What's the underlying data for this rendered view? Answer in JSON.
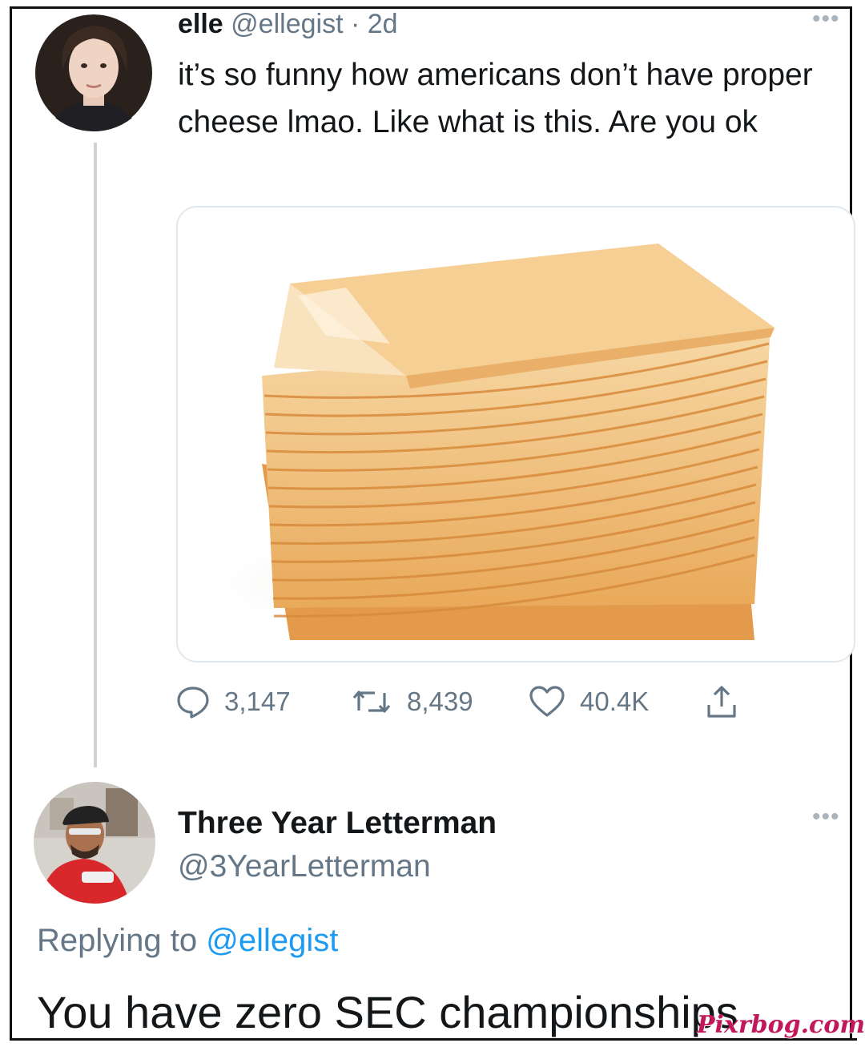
{
  "tweet": {
    "display_name": "elle",
    "handle": "@ellegist",
    "separator": "·",
    "time": "2d",
    "text": "it’s so funny how americans don’t have proper cheese lmao. Like what is this. Are you ok",
    "more_label": "•••",
    "actions": {
      "replies": "3,147",
      "retweets": "8,439",
      "likes": "40.4K"
    },
    "icons": [
      "reply-icon",
      "retweet-icon",
      "like-icon",
      "share-icon"
    ]
  },
  "reply": {
    "display_name": "Three Year Letterman",
    "handle": "@3YearLetterman",
    "replying_prefix": "Replying to",
    "replying_to": "@ellegist",
    "text": "You have zero SEC championships",
    "more_label": "•••"
  },
  "watermark": "Pixrbog.com",
  "colors": {
    "text": "#14171a",
    "secondary": "#657786",
    "link": "#1d9bf0",
    "thread_line": "#cfd3d6",
    "cheese": "#f2b96a"
  }
}
